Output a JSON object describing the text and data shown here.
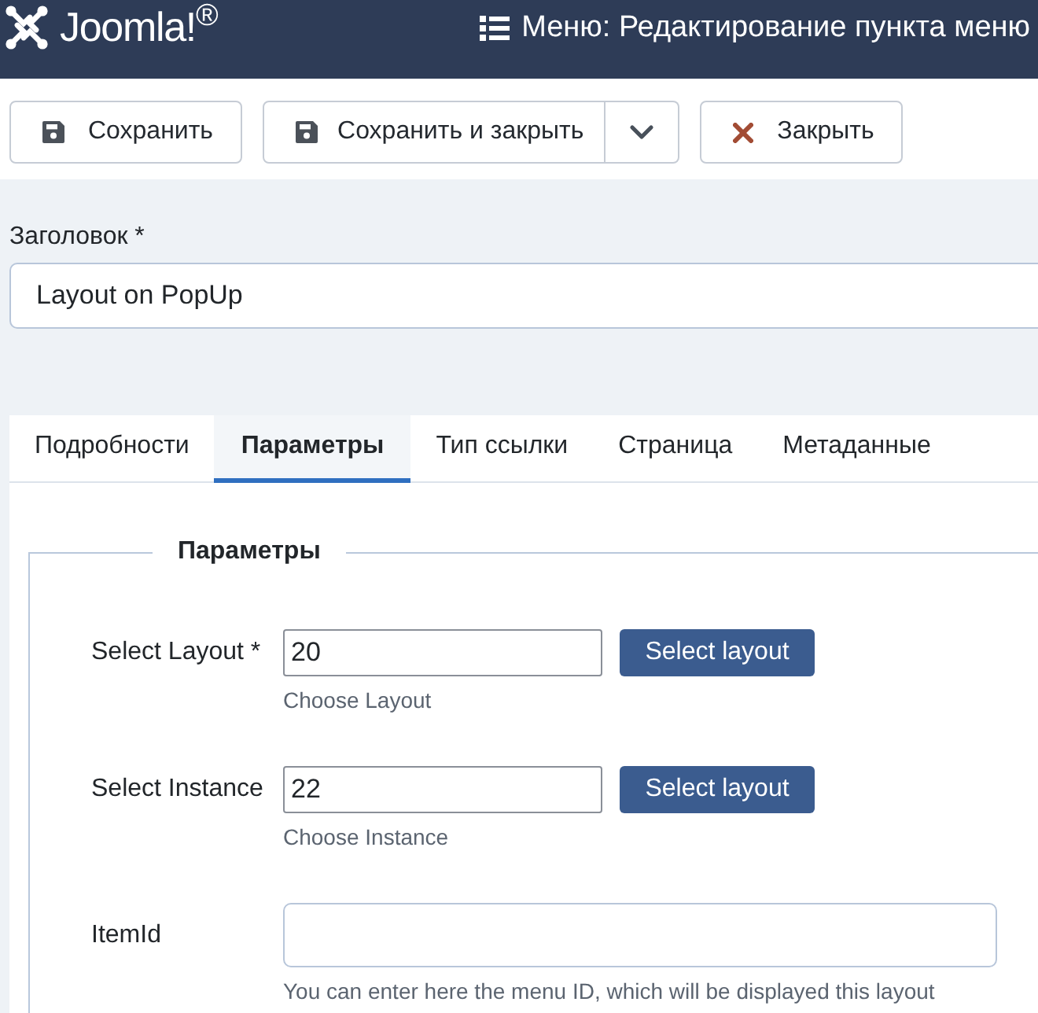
{
  "header": {
    "wordmark": "Joomla!$^{®}$",
    "title": "Меню: Редактирование пункта меню"
  },
  "toolbar": [
    {
      "kind": "save",
      "label": "Сохранить"
    },
    {
      "kind": "save-split",
      "label": "Сохранить и закрыть"
    },
    {
      "kind": "close",
      "label": "Закрыть"
    }
  ],
  "title_field": {
    "label": "Заголовок *",
    "value": "Layout on PopUp"
  },
  "tabs": [
    {
      "label": "Подробности",
      "selected": false
    },
    {
      "label": "Параметры",
      "selected": true
    },
    {
      "label": "Тип ссылки",
      "selected": false
    },
    {
      "label": "Страница",
      "selected": false
    },
    {
      "label": "Метаданные",
      "selected": false
    }
  ],
  "fieldset": {
    "legend": "Параметры",
    "fields": [
      {
        "kind": "picker",
        "label": "Select Layout *",
        "value": "20",
        "button": "Select layout",
        "help": "Choose Layout"
      },
      {
        "kind": "picker",
        "label": "Select Instance",
        "value": "22",
        "button": "Select layout",
        "help": "Choose Instance"
      },
      {
        "kind": "text",
        "label": "ItemId",
        "help": "You can enter here the menu ID, which will be displayed this layout"
      }
    ]
  }
}
